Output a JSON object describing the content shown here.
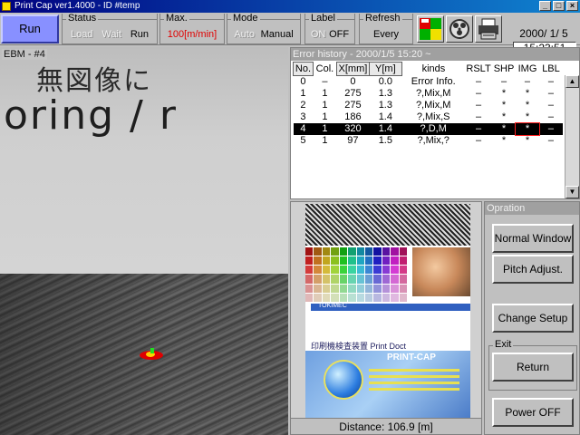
{
  "window": {
    "title": "Print Cap ver1.4000 - ID #temp",
    "controls": [
      "_",
      "□",
      "×"
    ]
  },
  "toolbar": {
    "run_label": "Run",
    "status": {
      "title": "Status",
      "options": [
        "Load",
        "Wait",
        "Run"
      ]
    },
    "max": {
      "title": "Max.",
      "value": "100[m/min]"
    },
    "mode": {
      "title": "Mode",
      "options": [
        "Auto",
        "Manual"
      ]
    },
    "label": {
      "title": "Label",
      "options": [
        "ON",
        "OFF"
      ]
    },
    "refresh": {
      "title": "Refresh",
      "value": "Every"
    },
    "icons": [
      "color-grid-icon",
      "film-reel-icon",
      "printer-icon"
    ],
    "date": "2000/ 1/ 5",
    "time": "15:23:51"
  },
  "camera": {
    "label": "EBM - #4",
    "overlay_line1": "無図像に",
    "overlay_line2": "oring / r"
  },
  "history": {
    "title": "Error history - 2000/1/5 15:20 ~",
    "columns": [
      "No.",
      "Col.",
      "X[mm]",
      "Y[m]",
      "kinds",
      "RSLT",
      "SHP",
      "IMG",
      "LBL"
    ],
    "rows": [
      [
        "0",
        "–",
        "0",
        "0.0",
        "Error Info.",
        "–",
        "–",
        "–",
        "–"
      ],
      [
        "1",
        "1",
        "275",
        "1.3",
        "?,Mix,M",
        "–",
        "*",
        "*",
        "–"
      ],
      [
        "2",
        "1",
        "275",
        "1.3",
        "?,Mix,M",
        "–",
        "*",
        "*",
        "–"
      ],
      [
        "3",
        "1",
        "186",
        "1.4",
        "?,Mix,S",
        "–",
        "*",
        "*",
        "–"
      ],
      [
        "4",
        "1",
        "320",
        "1.4",
        "?,D,M",
        "–",
        "*",
        "*",
        "–"
      ],
      [
        "5",
        "1",
        "97",
        "1.5",
        "?,Mix,?",
        "–",
        "*",
        "*",
        "–"
      ]
    ],
    "selected_row": 4
  },
  "preview": {
    "tk_text": "TOKIMEC",
    "banner_text": "印刷機検査装置  Print Doct",
    "brand_text": "PRINT-CAP",
    "distance": "Distance: 106.9 [m]"
  },
  "operation": {
    "title": "Opration",
    "normal_window": "Normal Window",
    "pitch_adjust": "Pitch Adjust.",
    "change_setup": "Change Setup",
    "exit_title": "Exit",
    "return": "Return",
    "power_off": "Power OFF"
  },
  "colors": {
    "run_button": "#8890ff",
    "titlebar": "#000080",
    "max_value": "#e00000"
  }
}
